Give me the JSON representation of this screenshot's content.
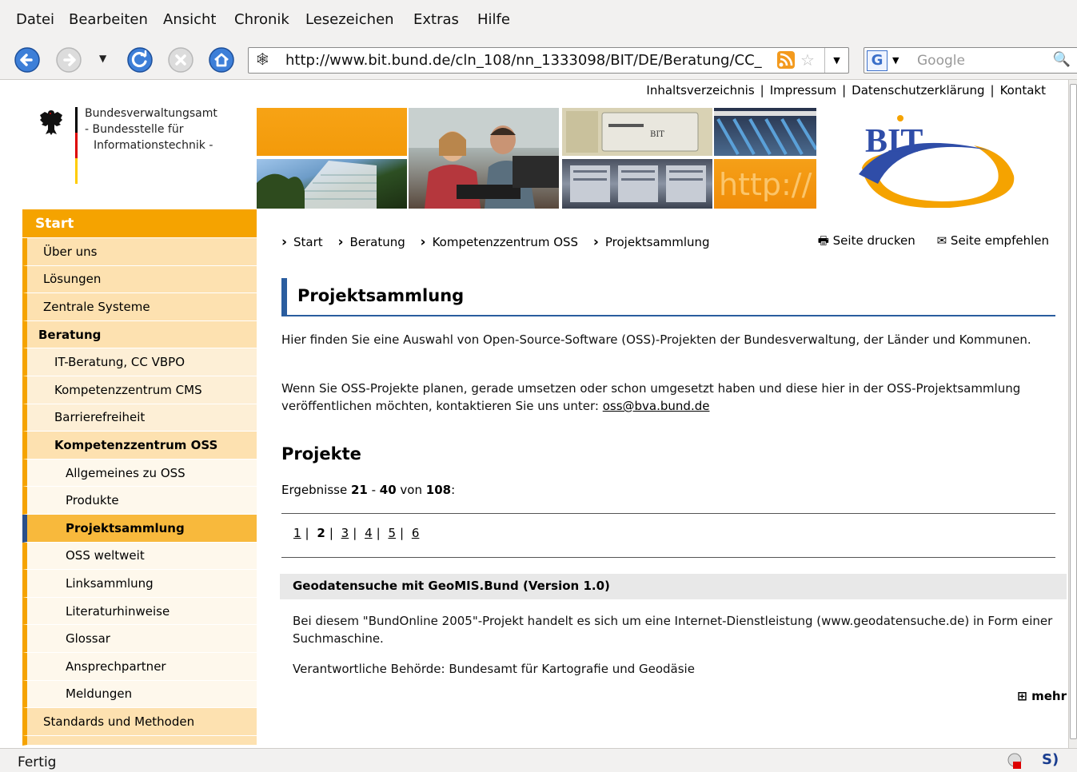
{
  "browser": {
    "menu": [
      "Datei",
      "Bearbeiten",
      "Ansicht",
      "Chronik",
      "Lesezeichen",
      "Extras",
      "Hilfe"
    ],
    "url": "http://www.bit.bund.de/cln_108/nn_1333098/BIT/DE/Beratung/CC_",
    "search_placeholder": "Google",
    "search_engine_letter": "G",
    "status": "Fertig",
    "status_icon_right": "S)"
  },
  "header": {
    "links": [
      "Inhaltsverzeichnis",
      "Impressum",
      "Datenschutzerklärung",
      "Kontakt"
    ],
    "separator": "|",
    "logo_lines": [
      "Bundesverwaltungsamt",
      "- Bundesstelle für",
      "Informationstechnik -"
    ],
    "banner_http_text": "http://",
    "bit_logo_text": "BIT"
  },
  "sidebar": {
    "start": "Start",
    "items": [
      {
        "label": "Über uns"
      },
      {
        "label": "Lösungen"
      },
      {
        "label": "Zentrale Systeme"
      },
      {
        "label": "Beratung"
      },
      {
        "label": "IT-Beratung, CC VBPO"
      },
      {
        "label": "Kompetenzzentrum CMS"
      },
      {
        "label": "Barrierefreiheit"
      },
      {
        "label": "Kompetenzzentrum OSS"
      },
      {
        "label": "Allgemeines zu OSS"
      },
      {
        "label": "Produkte"
      },
      {
        "label": "Projektsammlung"
      },
      {
        "label": "OSS weltweit"
      },
      {
        "label": "Linksammlung"
      },
      {
        "label": "Literaturhinweise"
      },
      {
        "label": "Glossar"
      },
      {
        "label": "Ansprechpartner"
      },
      {
        "label": "Meldungen"
      },
      {
        "label": "Standards und Methoden"
      }
    ]
  },
  "main": {
    "breadcrumb": [
      "Start",
      "Beratung",
      "Kompetenzzentrum OSS",
      "Projektsammlung"
    ],
    "print_label": "Seite drucken",
    "recommend_label": "Seite empfehlen",
    "title": "Projektsammlung",
    "intro1": "Hier finden Sie eine Auswahl von Open-Source-Software (OSS)-Projekten der Bundesverwaltung, der Länder und Kommunen.",
    "intro2_text": "Wenn Sie OSS-Projekte planen, gerade umsetzen oder schon umgesetzt haben und diese hier in der OSS-Projektsammlung veröffentlichen möchten, kontaktieren Sie uns unter: ",
    "intro2_email": "oss@bva.bund.de",
    "section_title": "Projekte",
    "results": {
      "prefix": "Ergebnisse ",
      "from": "21",
      "dash": " - ",
      "to": "40",
      "of": " von ",
      "total": "108",
      "suffix": ":"
    },
    "pages": [
      "1",
      "2",
      "3",
      "4",
      "5",
      "6"
    ],
    "current_page": "2",
    "project": {
      "title": "Geodatensuche mit GeoMIS.Bund (Version 1.0)",
      "desc": "Bei diesem \"BundOnline 2005\"-Projekt handelt es sich um eine Internet-Dienstleistung (www.geodatensuche.de) in Form einer Suchmaschine.",
      "authority": "Verantwortliche Behörde: Bundesamt für Kartografie und Geodäsie",
      "more": "mehr"
    }
  },
  "colors": {
    "accent": "#f5a300",
    "nav_blue": "#2a5d9f",
    "nav_light": "#fde1b0"
  }
}
